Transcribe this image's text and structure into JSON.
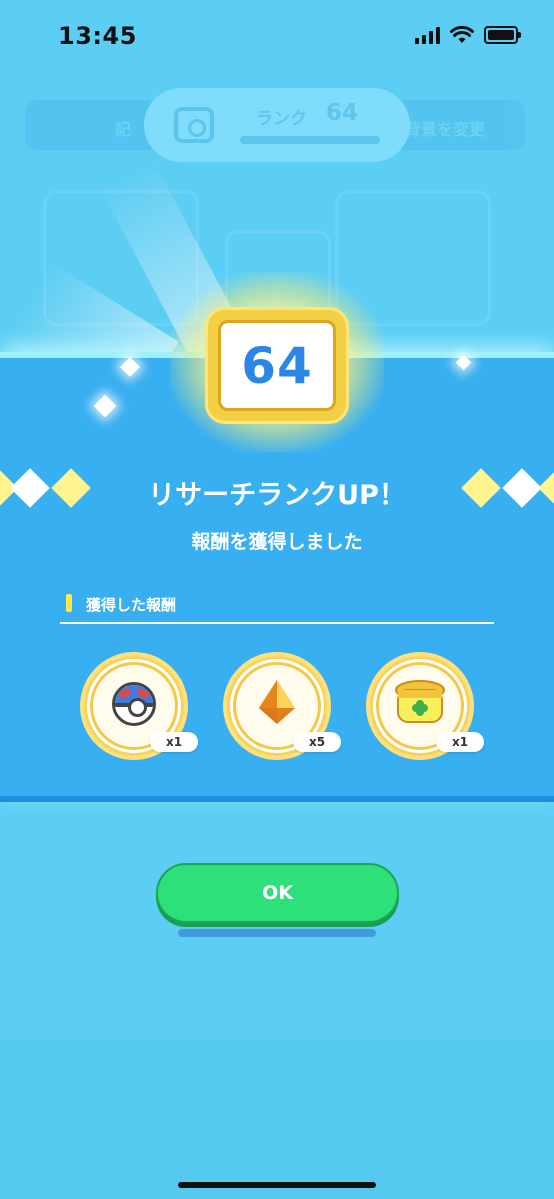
{
  "status_bar": {
    "time": "13:45"
  },
  "background": {
    "rank_label": "ランク",
    "rank_value": "64",
    "left_text": "記",
    "right_text": "背景を変更"
  },
  "badge": {
    "rank": "64"
  },
  "modal": {
    "title": "リサーチランクUP！",
    "subtitle": "報酬を獲得しました",
    "section_title": "獲得した報酬",
    "rewards": [
      {
        "icon": "ball-icon",
        "count": "x1"
      },
      {
        "icon": "gem-icon",
        "count": "x5"
      },
      {
        "icon": "incense-pot-icon",
        "count": "x1"
      }
    ],
    "ok_label": "OK"
  },
  "colors": {
    "background": "#5ccdf3",
    "band": "#38aff0",
    "accent_yellow": "#f3cf43",
    "ok_green": "#2ee07a",
    "rank_blue": "#2b86e6"
  }
}
